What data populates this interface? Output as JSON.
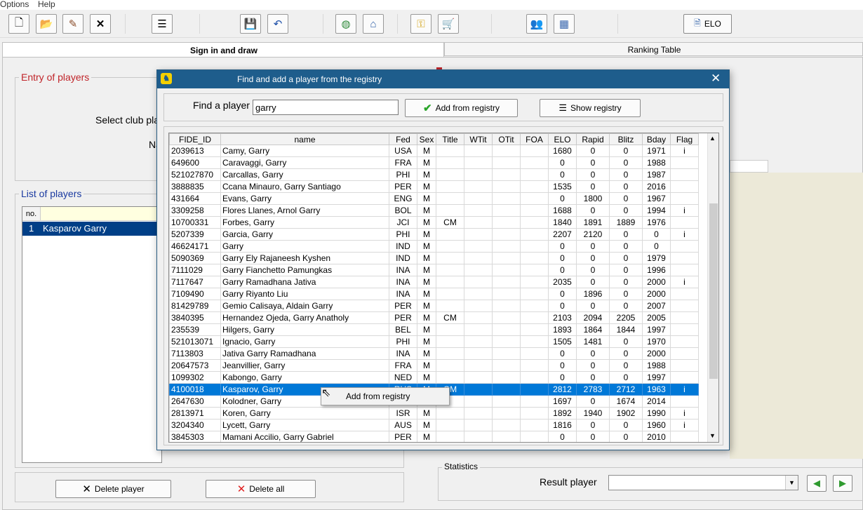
{
  "menu": [
    "Options",
    "Help"
  ],
  "toolbar": {
    "elo_label": "ELO"
  },
  "tabs": {
    "sign_in": "Sign in and draw",
    "ranking": "Ranking Table"
  },
  "left": {
    "entry_title": "Entry of players",
    "select_club": "Select club pla",
    "name_label": "Na",
    "list_title": "List of players",
    "list_header": "no.",
    "list_rows": [
      {
        "no": "1",
        "name": "Kasparov Garry"
      }
    ],
    "delete_player": "Delete player",
    "delete_all": "Delete all"
  },
  "right": {
    "statistics": "Statistics",
    "result_player": "Result player"
  },
  "dialog": {
    "title": "Find and add a player from the registry",
    "find_label": "Find a player",
    "find_value": "garry",
    "add_btn": "Add from registry",
    "show_btn": "Show registry",
    "columns": [
      "FIDE_ID",
      "name",
      "Fed",
      "Sex",
      "Title",
      "WTit",
      "OTit",
      "FOA",
      "ELO",
      "Rapid",
      "Blitz",
      "Bday",
      "Flag"
    ],
    "rows": [
      [
        "2039613",
        "Camy, Garry",
        "USA",
        "M",
        "",
        "",
        "",
        "",
        "1680",
        "0",
        "0",
        "1971",
        "i"
      ],
      [
        "649600",
        "Caravaggi, Garry",
        "FRA",
        "M",
        "",
        "",
        "",
        "",
        "0",
        "0",
        "0",
        "1988",
        ""
      ],
      [
        "521027870",
        "Carcallas, Garry",
        "PHI",
        "M",
        "",
        "",
        "",
        "",
        "0",
        "0",
        "0",
        "1987",
        ""
      ],
      [
        "3888835",
        "Ccana Minauro, Garry Santiago",
        "PER",
        "M",
        "",
        "",
        "",
        "",
        "1535",
        "0",
        "0",
        "2016",
        ""
      ],
      [
        "431664",
        "Evans, Garry",
        "ENG",
        "M",
        "",
        "",
        "",
        "",
        "0",
        "1800",
        "0",
        "1967",
        ""
      ],
      [
        "3309258",
        "Flores Llanes, Arnol Garry",
        "BOL",
        "M",
        "",
        "",
        "",
        "",
        "1688",
        "0",
        "0",
        "1994",
        "i"
      ],
      [
        "10700331",
        "Forbes, Garry",
        "JCI",
        "M",
        "CM",
        "",
        "",
        "",
        "1840",
        "1891",
        "1889",
        "1976",
        ""
      ],
      [
        "5207339",
        "Garcia, Garry",
        "PHI",
        "M",
        "",
        "",
        "",
        "",
        "2207",
        "2120",
        "0",
        "0",
        "i"
      ],
      [
        "46624171",
        "Garry",
        "IND",
        "M",
        "",
        "",
        "",
        "",
        "0",
        "0",
        "0",
        "0",
        ""
      ],
      [
        "5090369",
        "Garry Ely Rajaneesh Kyshen",
        "IND",
        "M",
        "",
        "",
        "",
        "",
        "0",
        "0",
        "0",
        "1979",
        ""
      ],
      [
        "7111029",
        "Garry Fianchetto Pamungkas",
        "INA",
        "M",
        "",
        "",
        "",
        "",
        "0",
        "0",
        "0",
        "1996",
        ""
      ],
      [
        "7117647",
        "Garry Ramadhana Jativa",
        "INA",
        "M",
        "",
        "",
        "",
        "",
        "2035",
        "0",
        "0",
        "2000",
        "i"
      ],
      [
        "7109490",
        "Garry Riyanto Liu",
        "INA",
        "M",
        "",
        "",
        "",
        "",
        "0",
        "1896",
        "0",
        "2000",
        ""
      ],
      [
        "81429789",
        "Gemio Calisaya, Aldain Garry",
        "PER",
        "M",
        "",
        "",
        "",
        "",
        "0",
        "0",
        "0",
        "2007",
        ""
      ],
      [
        "3840395",
        "Hernandez Ojeda, Garry Anatholy",
        "PER",
        "M",
        "CM",
        "",
        "",
        "",
        "2103",
        "2094",
        "2205",
        "2005",
        ""
      ],
      [
        "235539",
        "Hilgers, Garry",
        "BEL",
        "M",
        "",
        "",
        "",
        "",
        "1893",
        "1864",
        "1844",
        "1997",
        ""
      ],
      [
        "521013071",
        "Ignacio, Garry",
        "PHI",
        "M",
        "",
        "",
        "",
        "",
        "1505",
        "1481",
        "0",
        "1970",
        ""
      ],
      [
        "7113803",
        "Jativa Garry Ramadhana",
        "INA",
        "M",
        "",
        "",
        "",
        "",
        "0",
        "0",
        "0",
        "2000",
        ""
      ],
      [
        "20647573",
        "Jeanvillier, Garry",
        "FRA",
        "M",
        "",
        "",
        "",
        "",
        "0",
        "0",
        "0",
        "1988",
        ""
      ],
      [
        "1099302",
        "Kabongo, Garry",
        "NED",
        "M",
        "",
        "",
        "",
        "",
        "0",
        "0",
        "0",
        "1997",
        ""
      ],
      [
        "4100018",
        "Kasparov, Garry",
        "RUS",
        "M",
        "GM",
        "",
        "",
        "",
        "2812",
        "2783",
        "2712",
        "1963",
        "i"
      ],
      [
        "2647630",
        "Kolodner, Garry",
        "USA",
        "M",
        "",
        "",
        "",
        "",
        "1697",
        "0",
        "1674",
        "2014",
        ""
      ],
      [
        "2813971",
        "Koren, Garry",
        "ISR",
        "M",
        "",
        "",
        "",
        "",
        "1892",
        "1940",
        "1902",
        "1990",
        "i"
      ],
      [
        "3204340",
        "Lycett, Garry",
        "AUS",
        "M",
        "",
        "",
        "",
        "",
        "1816",
        "0",
        "0",
        "1960",
        "i"
      ],
      [
        "3845303",
        "Mamani Accilio, Garry Gabriel",
        "PER",
        "M",
        "",
        "",
        "",
        "",
        "0",
        "0",
        "0",
        "2010",
        ""
      ]
    ],
    "selected_row": 20
  },
  "context_menu": {
    "item": "Add from registry"
  }
}
